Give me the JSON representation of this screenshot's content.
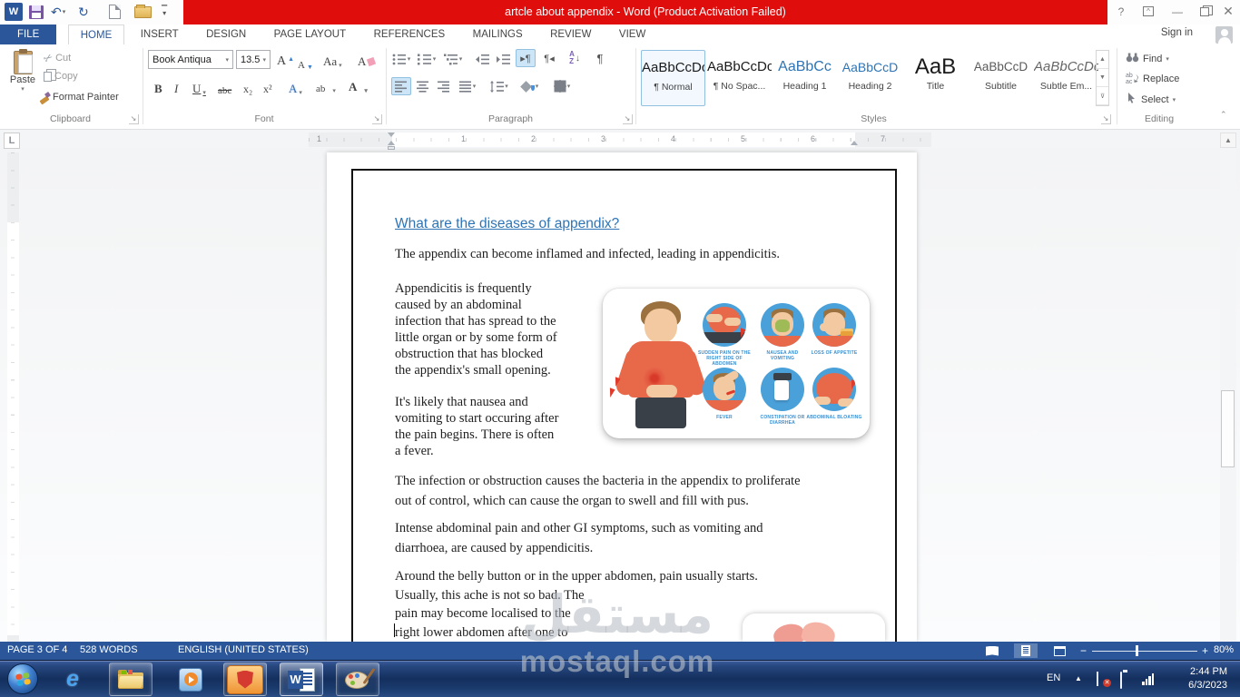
{
  "window": {
    "title": "artcle about appendix -  Word (Product Activation Failed)",
    "sign_in": "Sign in"
  },
  "ribbon": {
    "tabs": [
      {
        "label": "FILE"
      },
      {
        "label": "HOME"
      },
      {
        "label": "INSERT"
      },
      {
        "label": "DESIGN"
      },
      {
        "label": "PAGE LAYOUT"
      },
      {
        "label": "REFERENCES"
      },
      {
        "label": "MAILINGS"
      },
      {
        "label": "REVIEW"
      },
      {
        "label": "VIEW"
      }
    ],
    "clipboard": {
      "group_label": "Clipboard",
      "paste": "Paste",
      "cut": "Cut",
      "copy": "Copy",
      "format_painter": "Format Painter"
    },
    "font": {
      "group_label": "Font",
      "font_name": "Book Antiqua",
      "font_size": "13.5",
      "bold": "B",
      "italic": "I",
      "underline": "U",
      "strikethrough": "abc",
      "subscript": "x₂",
      "superscript": "x²",
      "grow": "A",
      "shrink": "A",
      "change_case": "Aa",
      "text_effects": "A",
      "highlight": "ab",
      "font_color": "A"
    },
    "paragraph": {
      "group_label": "Paragraph",
      "pilcrow": "¶",
      "sort_a": "A",
      "sort_z": "Z"
    },
    "styles": {
      "group_label": "Styles",
      "items": [
        {
          "preview": "AaBbCcDc",
          "name": "¶ Normal"
        },
        {
          "preview": "AaBbCcDc",
          "name": "¶ No Spac..."
        },
        {
          "preview": "AaBbCc",
          "name": "Heading 1"
        },
        {
          "preview": "AaBbCcD",
          "name": "Heading 2"
        },
        {
          "preview": "AaB",
          "name": "Title"
        },
        {
          "preview": "AaBbCcD",
          "name": "Subtitle"
        },
        {
          "preview": "AaBbCcDc",
          "name": "Subtle Em..."
        }
      ]
    },
    "editing": {
      "group_label": "Editing",
      "find": "Find",
      "replace": "Replace",
      "select": "Select"
    }
  },
  "ruler": {
    "pre_margin": "1",
    "numbers": [
      "1",
      "2",
      "3",
      "4",
      "5",
      "6",
      "7"
    ],
    "tab_selector": "L"
  },
  "document": {
    "heading": "What are the diseases of appendix?",
    "para1": "The appendix can become inflamed and infected, leading in appendicitis.",
    "para2_lines": [
      "Appendicitis is frequently",
      "caused by an abdominal",
      "infection that has spread to the",
      "little organ or by some form of",
      "obstruction that has blocked",
      "the appendix's small opening."
    ],
    "para3_lines": [
      "It's likely that nausea and",
      "vomiting to start occuring after",
      "the pain begins. There is often",
      "a fever."
    ],
    "para4_lines": [
      "The infection or obstruction causes the bacteria in the appendix to proliferate",
      "out of control, which can cause the organ to swell and fill with pus."
    ],
    "para5_lines": [
      "Intense abdominal pain and other GI symptoms, such as vomiting and",
      "diarrhoea, are caused by appendicitis."
    ],
    "para6_lines": [
      "Around the belly button or in the upper abdomen, pain usually starts.",
      "Usually, this ache is not so bad. The",
      "pain may become localised to the",
      "right lower abdomen after one to"
    ],
    "infographic_symptoms": [
      "SUDDEN PAIN ON THE RIGHT SIDE OF ABDOMEN",
      "NAUSEA AND VOMITING",
      "LOSS OF APPETITE",
      "FEVER",
      "CONSTIPATION OR DIARRHEA",
      "ABDOMINAL BLOATING"
    ]
  },
  "status_bar": {
    "page": "PAGE 3 OF 4",
    "words": "528 WORDS",
    "language": "ENGLISH (UNITED STATES)",
    "zoom_level": "80%"
  },
  "tray": {
    "language": "EN",
    "time": "2:44 PM",
    "date": "6/3/2023"
  },
  "watermark": {
    "arabic": "مستقل",
    "latin": "mostaql.com"
  },
  "colors": {
    "accent": "#2b579a",
    "title_highlight": "#e00d0d",
    "heading_blue": "#2e74b5",
    "status_bar": "#2b579a"
  }
}
